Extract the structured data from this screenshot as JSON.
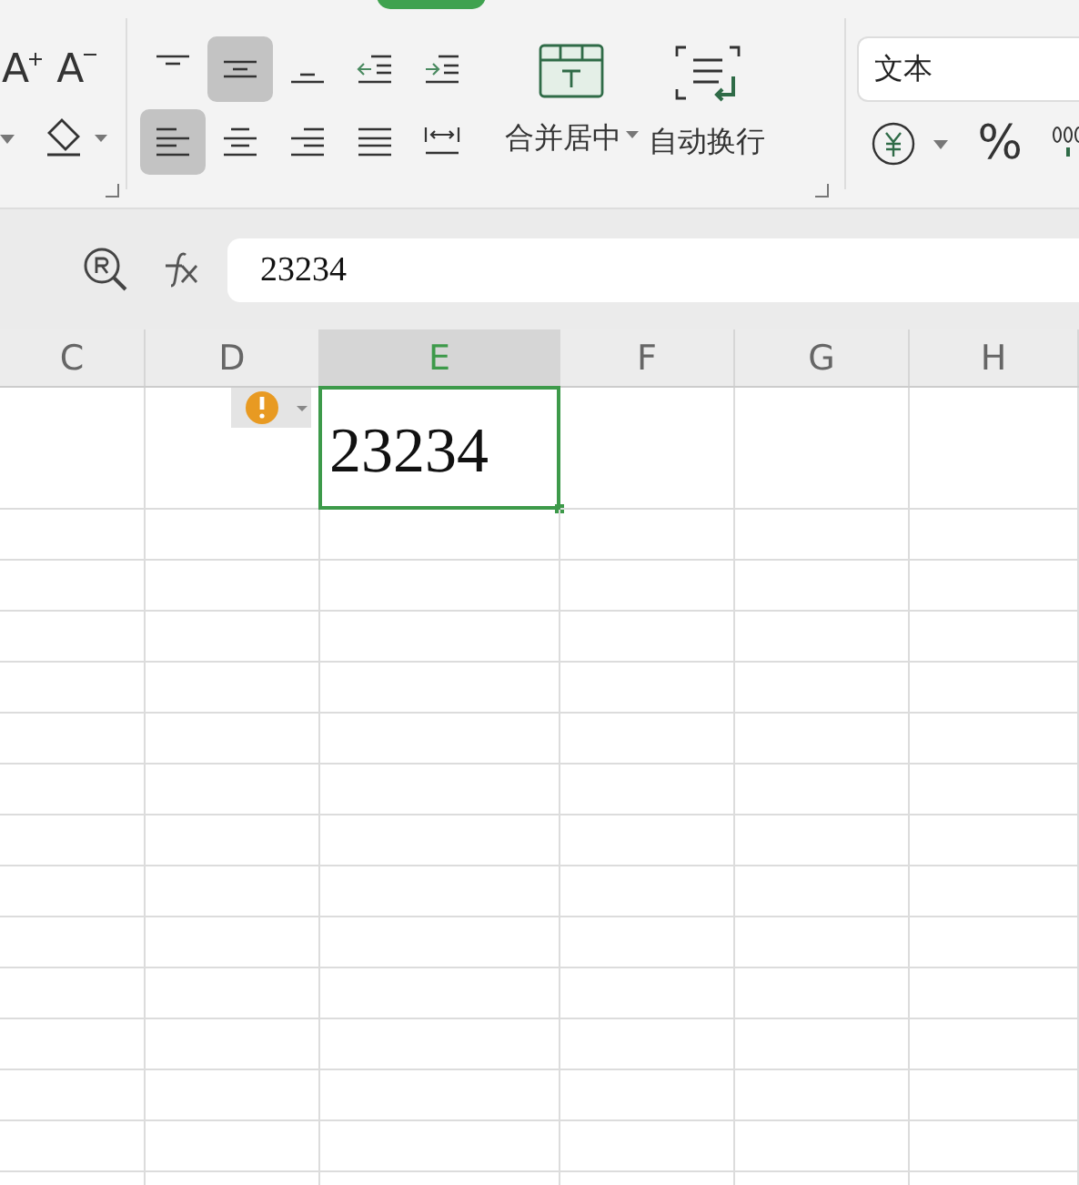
{
  "ribbon": {
    "font_grow": "A",
    "font_shrink": "A",
    "alignment_buttons": [
      {
        "kind": "top",
        "selected": false
      },
      {
        "kind": "middle",
        "selected": true
      },
      {
        "kind": "bottom",
        "selected": false
      },
      {
        "kind": "outdent",
        "selected": false
      },
      {
        "kind": "indent",
        "selected": false
      },
      {
        "kind": "left",
        "selected": true
      },
      {
        "kind": "center",
        "selected": false
      },
      {
        "kind": "right",
        "selected": false
      },
      {
        "kind": "justify",
        "selected": false
      },
      {
        "kind": "distributed",
        "selected": false
      }
    ],
    "merge_button": "合并居中",
    "wrap_button": "自动换行",
    "number_format": "文本",
    "percent": "%"
  },
  "formula_bar": {
    "value": "23234"
  },
  "columns": [
    {
      "label": "C",
      "selected": false
    },
    {
      "label": "D",
      "selected": false
    },
    {
      "label": "E",
      "selected": true
    },
    {
      "label": "F",
      "selected": false
    },
    {
      "label": "G",
      "selected": false
    },
    {
      "label": "H",
      "selected": false
    }
  ],
  "active_cell": {
    "value": "23234"
  }
}
